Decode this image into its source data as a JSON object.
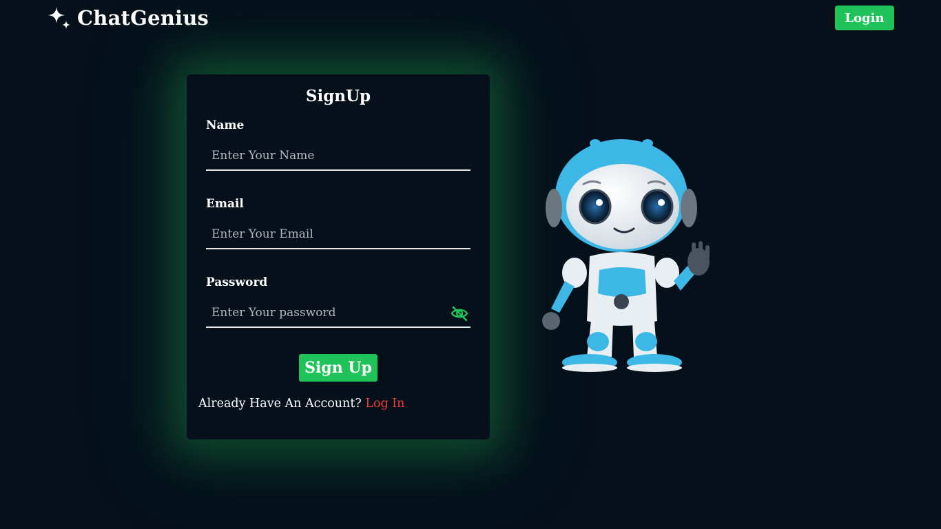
{
  "header": {
    "brand_name": "ChatGenius",
    "brand_icon": "sparkle-icon",
    "login_label": "Login"
  },
  "form": {
    "title": "SignUp",
    "name": {
      "label": "Name",
      "placeholder": "Enter Your Name",
      "value": ""
    },
    "email": {
      "label": "Email",
      "placeholder": "Enter Your Email",
      "value": ""
    },
    "password": {
      "label": "Password",
      "placeholder": "Enter Your password",
      "value": "",
      "toggle_icon": "eye-off-icon"
    },
    "submit_label": "Sign Up",
    "account_prompt": "Already Have An Account?",
    "login_link": "Log In"
  },
  "illustration": {
    "icon": "robot-mascot-illustration"
  },
  "colors": {
    "background": "#05101b",
    "accent_green": "#1fc35a",
    "link_red": "#ef3b3b",
    "robot_blue": "#3db8e6"
  }
}
